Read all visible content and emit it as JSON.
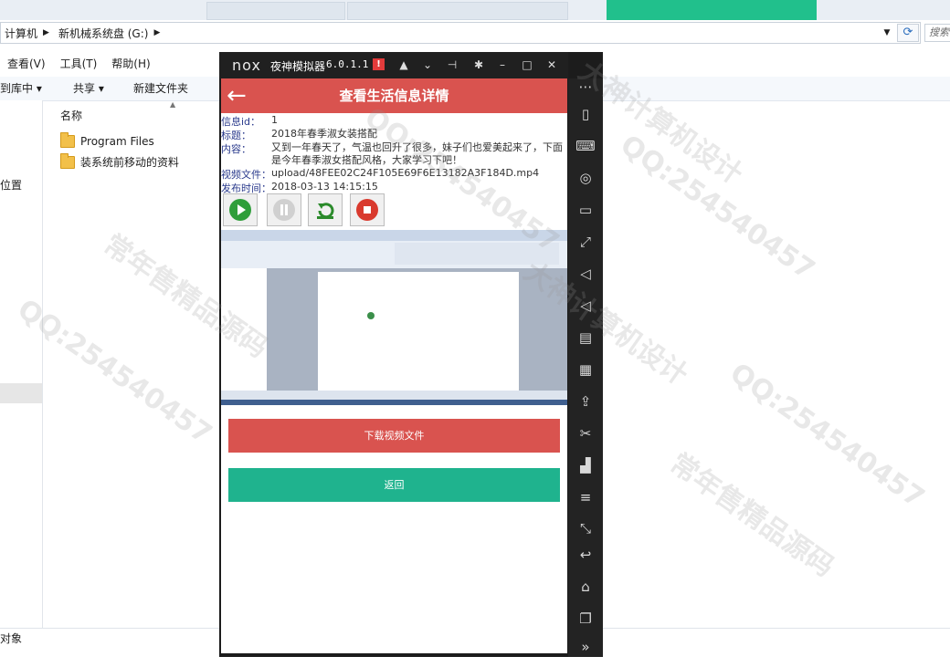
{
  "explorer": {
    "breadcrumb": [
      "计算机",
      "新机械系统盘 (G:)"
    ],
    "search_placeholder": "搜索",
    "menu": [
      "查看(V)",
      "工具(T)",
      "帮助(H)"
    ],
    "toolbar": [
      "到库中 ▾",
      "共享 ▾",
      "新建文件夹"
    ],
    "nav_item": "位置",
    "column_header": "名称",
    "files": [
      "Program Files",
      "装系统前移动的资料"
    ],
    "status": "对象"
  },
  "emulator": {
    "logo": "nox",
    "name": "夜神模拟器",
    "version": "6.0.1.1",
    "alert": "!"
  },
  "app": {
    "title": "查看生活信息详情",
    "fields": [
      {
        "label": "信息id：",
        "value": "1"
      },
      {
        "label": "标题：",
        "value": "2018年春季淑女装搭配"
      },
      {
        "label": "内容：",
        "value": "又到一年春天了，气温也回升了很多，妹子们也爱美起来了，下面是今年春季淑女搭配风格，大家学习下吧！"
      },
      {
        "label": "视频文件：",
        "value": "upload/48FEE02C24F105E69F6E13182A3F184D.mp4"
      },
      {
        "label": "发布时间：",
        "value": "2018-03-13 14:15:15"
      }
    ],
    "download_label": "下载视频文件",
    "back_label": "返回"
  },
  "watermarks": [
    "常年售精品源码",
    "QQ:254540457",
    "大神计算机设计"
  ],
  "colors": {
    "header_red": "#d9534f",
    "teal": "#1fb38e",
    "emulator_dark": "#1c1c1c"
  }
}
